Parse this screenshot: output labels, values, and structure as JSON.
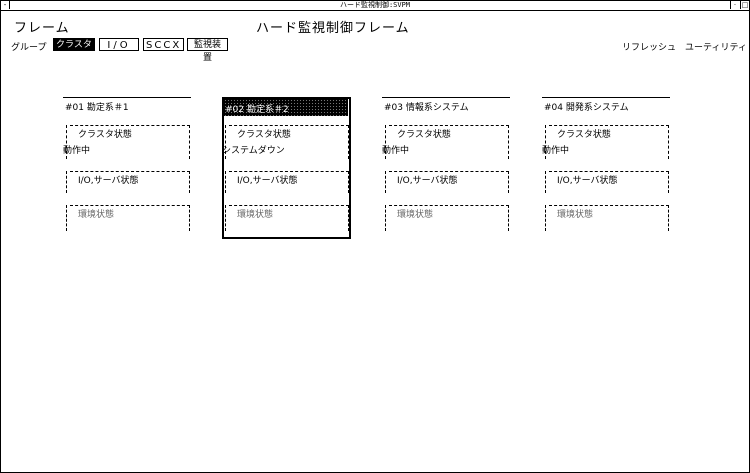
{
  "window": {
    "title": "ハード監視制御:SVPM"
  },
  "header": {
    "frame_label": "フレーム",
    "title": "ハード監視制御フレーム"
  },
  "group": {
    "label": "グループ",
    "buttons": [
      "クラスタ",
      "I/O",
      "SCCX",
      "監視装置"
    ],
    "selected": "クラスタ"
  },
  "links": {
    "refresh": "リフレッシュ",
    "utility": "ユーティリティ"
  },
  "cards": [
    {
      "title": "#01 勘定系＃1",
      "cluster_label": "クラスタ状態",
      "cluster_status": "動作中",
      "io_label": "I/O,サーバ状態",
      "env_label": "環境状態"
    },
    {
      "title": "#02 勘定系＃2",
      "cluster_label": "クラスタ状態",
      "cluster_status": "システムダウン",
      "io_label": "I/O,サーバ状態",
      "env_label": "環境状態"
    },
    {
      "title": "#03 情報系システム",
      "cluster_label": "クラスタ状態",
      "cluster_status": "動作中",
      "io_label": "I/O,サーバ状態",
      "env_label": "環境状態"
    },
    {
      "title": "#04 開発系システム",
      "cluster_label": "クラスタ状態",
      "cluster_status": "動作中",
      "io_label": "I/O,サーバ状態",
      "env_label": "環境状態"
    }
  ]
}
